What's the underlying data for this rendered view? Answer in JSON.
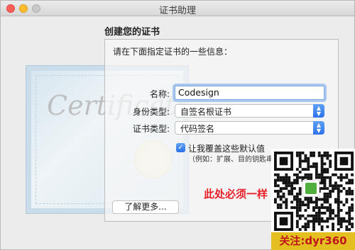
{
  "window": {
    "title": "证书助理"
  },
  "heading": "创建您的证书",
  "instruction": "请在下面指定证书的一些信息：",
  "fields": {
    "name_label": "名称:",
    "name_value": "Codesign",
    "identity_type_label": "身份类型:",
    "identity_type_value": "自签名根证书",
    "cert_type_label": "证书类型:",
    "cert_type_value": "代码签名"
  },
  "override": {
    "label": "让我覆盖这些默认值",
    "hint": "（例如：扩展、目的钥匙串等等）",
    "checked": true
  },
  "red_note": "此处必须一样",
  "learn_more_button": "了解更多...",
  "qr": {
    "caption": "关注:dyr360"
  },
  "cert_artwork_text": "Certificate",
  "colors": {
    "accent": "#2b72ea",
    "note_red": "#e8202a"
  }
}
